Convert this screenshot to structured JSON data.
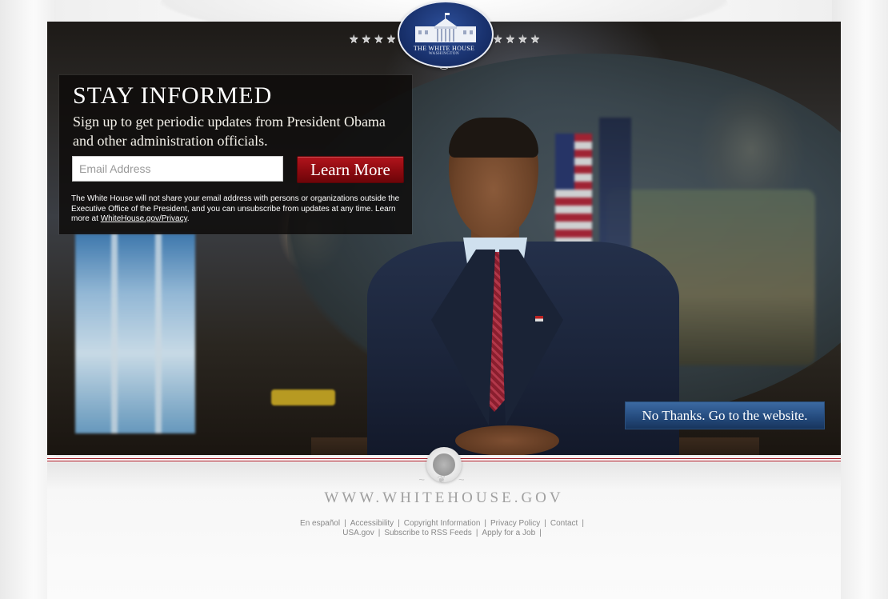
{
  "logo": {
    "name": "THE WHITE HOUSE",
    "location": "WASHINGTON",
    "stars_left": "★★★★",
    "stars_right": "★★★★"
  },
  "signup": {
    "heading": "STAY INFORMED",
    "subtext": "Sign up to get periodic updates from President Obama and other administration officials.",
    "email_placeholder": "Email Address",
    "email_value": "",
    "submit_label": "Learn More",
    "privacy_text": "The White House will not share your email address with persons or organizations outside the Executive Office of the President, and you can unsubscribe from updates at any time. Learn more at ",
    "privacy_link": "WhiteHouse.gov/Privacy",
    "privacy_end": "."
  },
  "skip_button": "No Thanks. Go to the website.",
  "site_url": "WWW.WHITEHOUSE.GOV",
  "footer": {
    "links": [
      "En español",
      "Accessibility",
      "Copyright Information",
      "Privacy Policy",
      "Contact",
      "USA.gov",
      "Subscribe to RSS Feeds",
      "Apply for a Job"
    ]
  },
  "colors": {
    "submit_button": "#8c0a10",
    "skip_button": "#254c7f",
    "logo_blue": "#18306b",
    "stripe_red": "#9b1520"
  }
}
